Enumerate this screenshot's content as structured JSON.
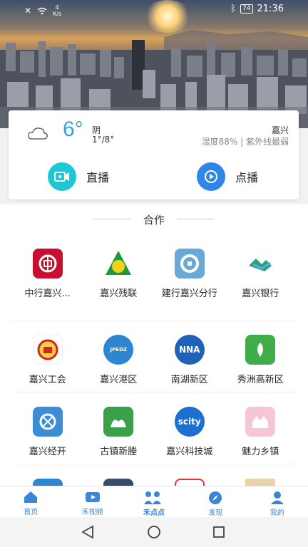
{
  "status_bar": {
    "speed_value": "4",
    "speed_unit": "K/s",
    "battery": "74",
    "time": "21:36"
  },
  "weather": {
    "icon": "cloud-icon",
    "temperature": "6°",
    "condition": "阴",
    "range": "1°/8°",
    "city": "嘉兴",
    "details": "湿度88% | 紫外线最弱",
    "live_label": "直播",
    "vod_label": "点播",
    "accent": "#3aa0e0"
  },
  "partners": {
    "title": "合作",
    "items": [
      {
        "label": "中行嘉兴...",
        "icon": "bank-of-china-logo",
        "color": "#c8102e"
      },
      {
        "label": "嘉兴残联",
        "icon": "disabled-federation-logo",
        "color": "#1a9a3a"
      },
      {
        "label": "建行嘉兴分行",
        "icon": "ccb-logo",
        "color": "#2c6fb7"
      },
      {
        "label": "嘉兴银行",
        "icon": "jiaxing-bank-logo",
        "color": "#2aa07a"
      },
      {
        "label": "嘉兴工会",
        "icon": "trade-union-logo",
        "color": "#d7261e"
      },
      {
        "label": "嘉兴港区",
        "icon": "jpedz-logo",
        "color": "#2e86d1"
      },
      {
        "label": "南湖新区",
        "icon": "nanhu-logo",
        "color": "#1e63b8"
      },
      {
        "label": "秀洲高新区",
        "icon": "hitech-logo",
        "color": "#3fae49"
      },
      {
        "label": "嘉兴经开",
        "icon": "jingkai-logo",
        "color": "#3b8ed6"
      },
      {
        "label": "古镇新塍",
        "icon": "xincheng-logo",
        "color": "#3aa14a"
      },
      {
        "label": "嘉兴科技城",
        "icon": "scity-logo",
        "color": "#1d6fd0"
      },
      {
        "label": "魅力乡镇",
        "icon": "town-logo",
        "color": "#f38bb0"
      }
    ]
  },
  "bottom_nav": [
    {
      "label": "首页",
      "icon": "home-icon"
    },
    {
      "label": "禾视频",
      "icon": "video-icon"
    },
    {
      "label": "禾点点",
      "icon": "people-icon"
    },
    {
      "label": "发现",
      "icon": "compass-icon"
    },
    {
      "label": "我的",
      "icon": "user-icon"
    }
  ]
}
